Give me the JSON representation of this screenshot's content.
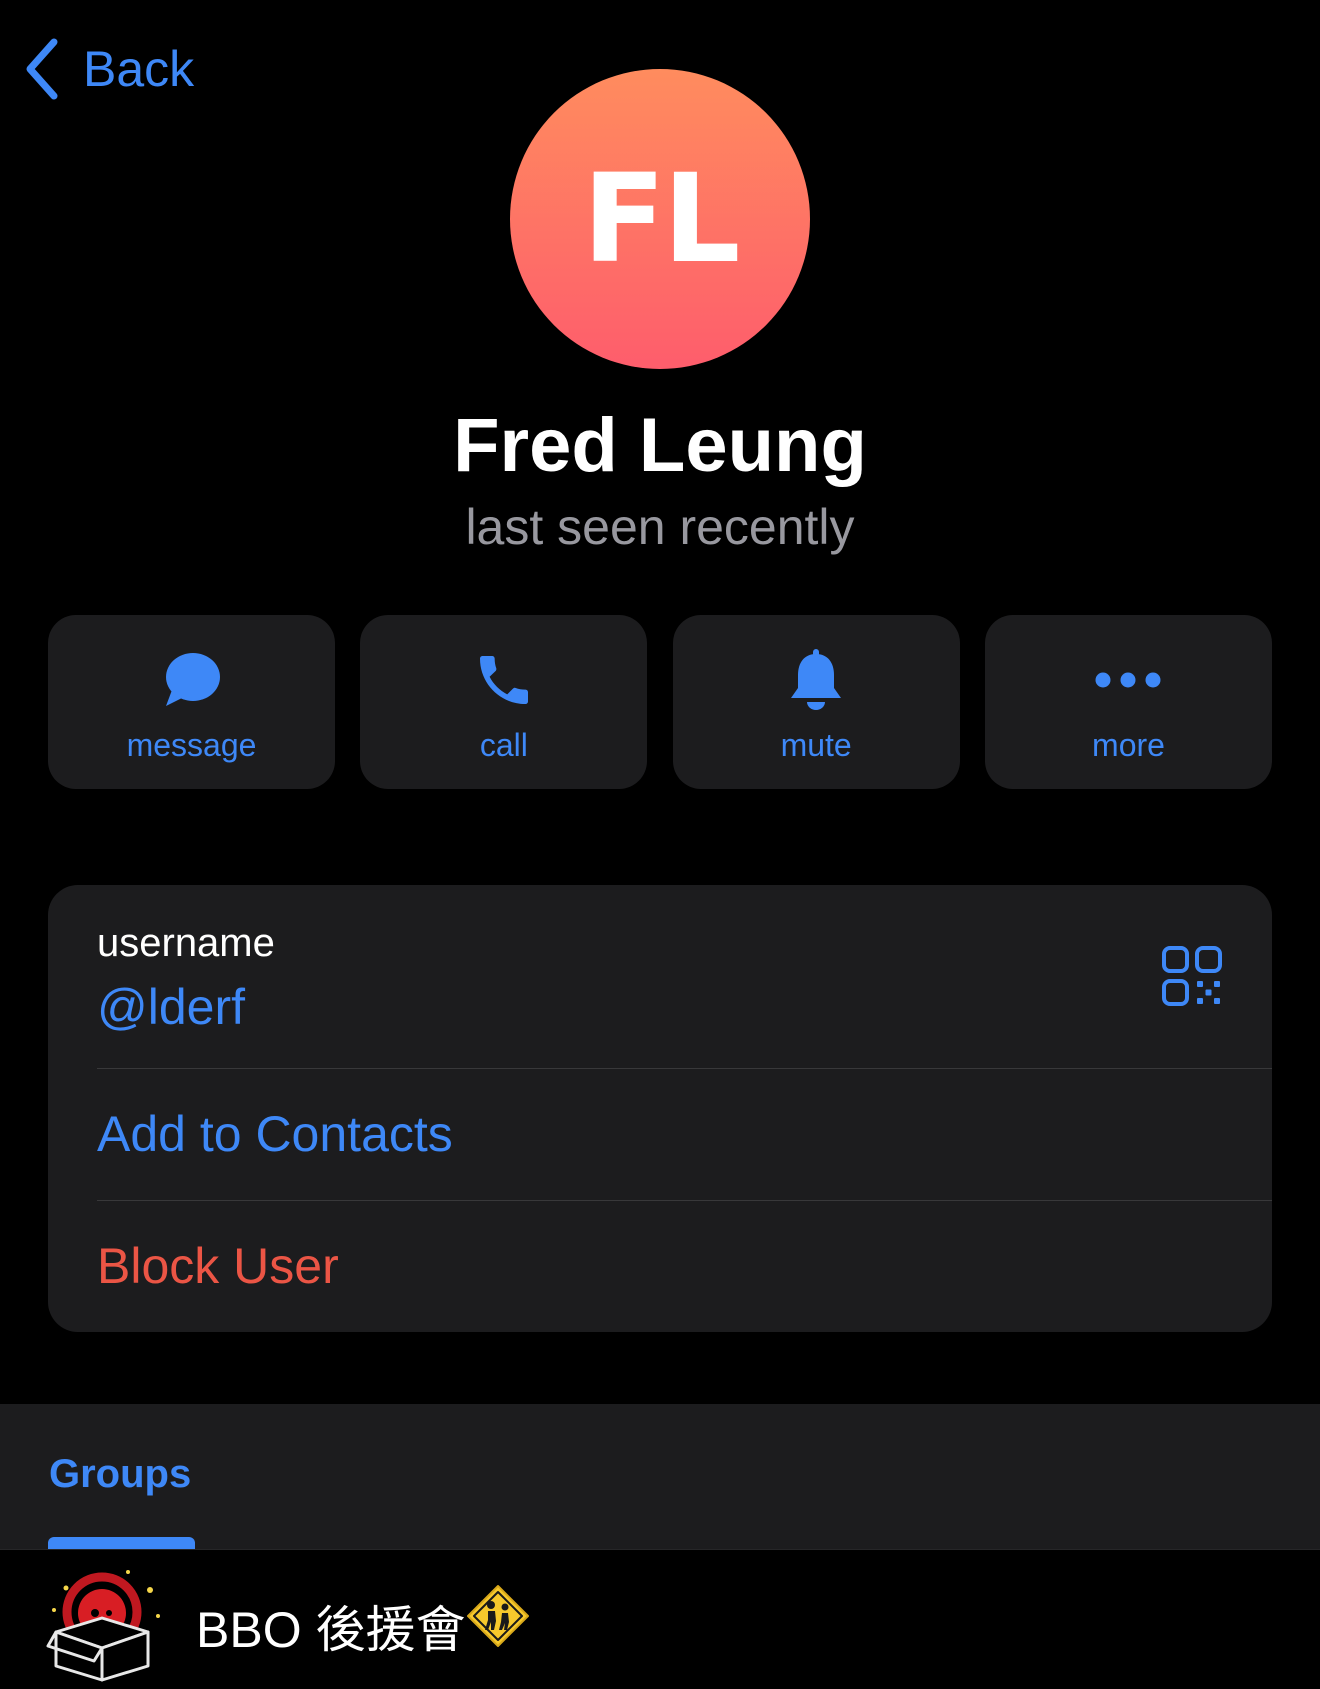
{
  "nav": {
    "back_label": "Back"
  },
  "profile": {
    "initials": "FL",
    "name": "Fred Leung",
    "status": "last seen recently"
  },
  "actions": [
    {
      "label": "message",
      "icon": "message-bubble-icon"
    },
    {
      "label": "call",
      "icon": "phone-icon"
    },
    {
      "label": "mute",
      "icon": "bell-icon"
    },
    {
      "label": "more",
      "icon": "more-dots-icon"
    }
  ],
  "info": {
    "username_label": "username",
    "username_value": "@lderf",
    "add_contact_label": "Add to Contacts",
    "block_label": "Block User"
  },
  "groups": {
    "tab_label": "Groups",
    "items": [
      {
        "name": "BBO 後援會"
      }
    ]
  },
  "colors": {
    "accent": "#3e88f7",
    "destructive": "#eb5545",
    "card": "#1c1c1e",
    "avatar_top": "#ff8c5e",
    "avatar_bottom": "#fe5d6c"
  }
}
